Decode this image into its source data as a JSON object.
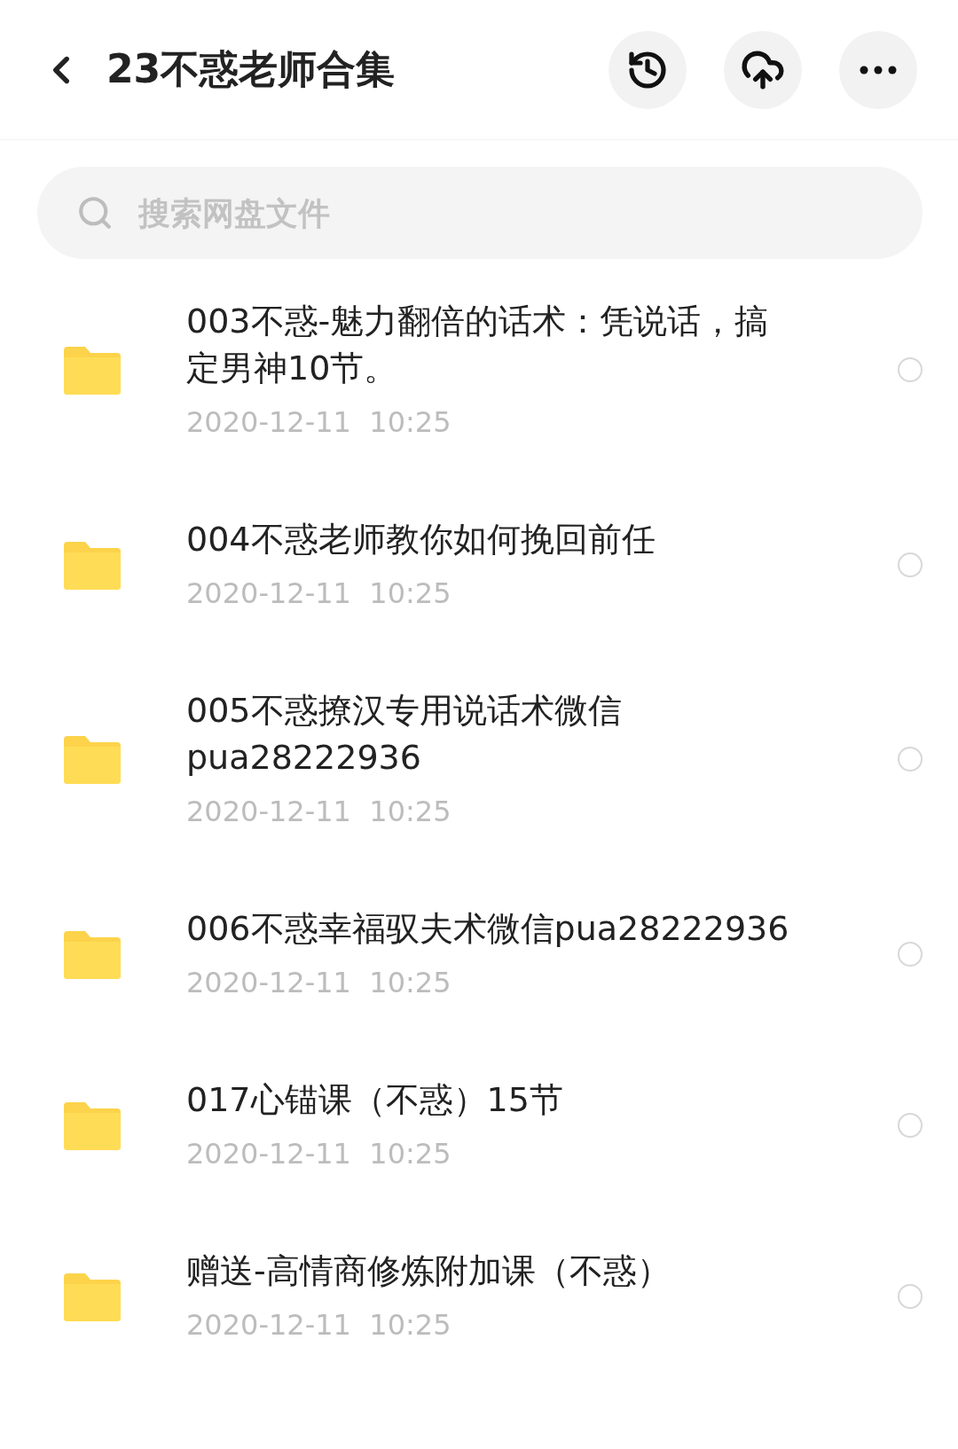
{
  "header": {
    "title": "23不惑老师合集"
  },
  "search": {
    "placeholder": "搜索网盘文件"
  },
  "files": [
    {
      "kind": "folder",
      "name": "003不惑-魅力翻倍的话术：凭说话，搞定男神10节。",
      "date": "2020-12-11  10:25",
      "selected": false
    },
    {
      "kind": "folder",
      "name": "004不惑老师教你如何挽回前任",
      "date": "2020-12-11  10:25",
      "selected": false
    },
    {
      "kind": "folder",
      "name": "005不惑撩汉专用说话术微信pua28222936",
      "date": "2020-12-11  10:25",
      "selected": false
    },
    {
      "kind": "folder",
      "name": "006不惑幸福驭夫术微信pua28222936",
      "date": "2020-12-11  10:25",
      "selected": false
    },
    {
      "kind": "folder",
      "name": "017心锚课（不惑）15节",
      "date": "2020-12-11  10:25",
      "selected": false
    },
    {
      "kind": "folder",
      "name": "赠送-高情商修炼附加课（不惑）",
      "date": "2020-12-11  10:25",
      "selected": false
    }
  ]
}
